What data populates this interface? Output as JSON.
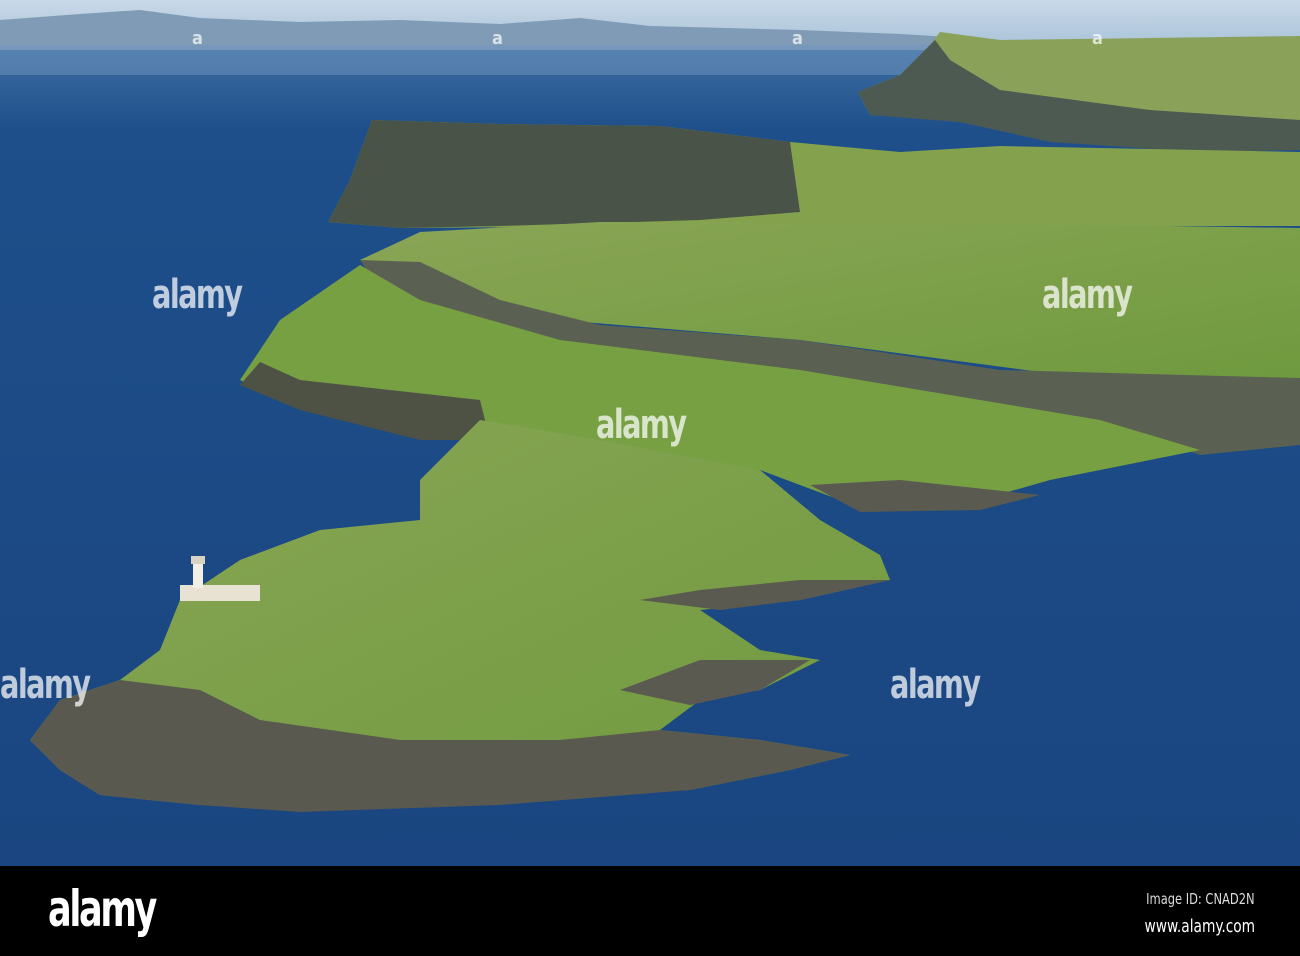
{
  "photo": {
    "subject": "coastal-headland-lighthouse"
  },
  "watermark": {
    "text": "alamy",
    "small_mark": "a"
  },
  "footer": {
    "logo": "alamy",
    "image_id": "Image ID: CNAD2N",
    "website": "www.alamy.com"
  }
}
